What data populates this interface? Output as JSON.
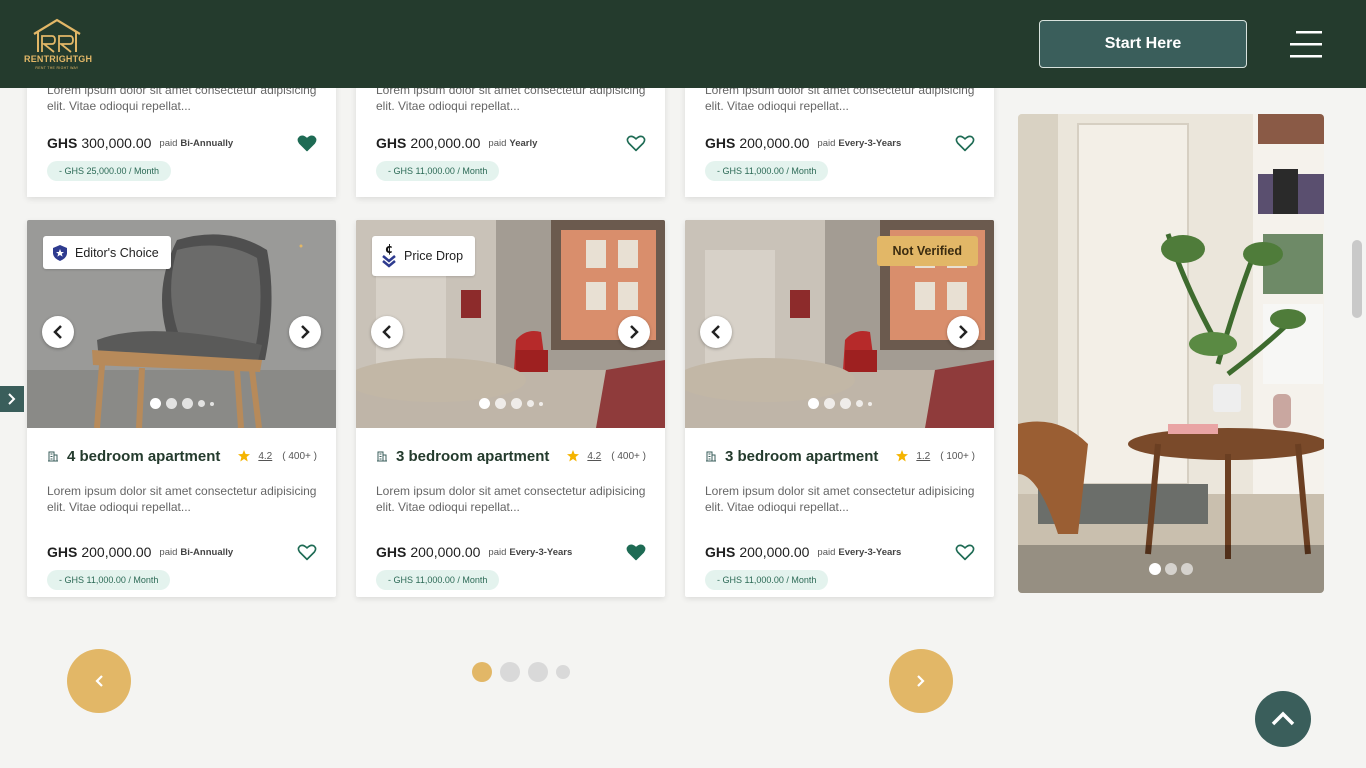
{
  "header": {
    "logo_text": "RENTRIGHTGH",
    "logo_tagline": "RENT THE RIGHT WAY",
    "start_button": "Start Here"
  },
  "top_cards": [
    {
      "desc": "Lorem ipsum dolor sit amet consectetur adipisicing elit. Vitae odioqui repellat...",
      "currency": "GHS",
      "amount": "300,000.00",
      "period_label": "paid",
      "period": "Bi-Annually",
      "monthly": "- GHS 25,000.00 / Month",
      "favorited": true
    },
    {
      "desc": "Lorem ipsum dolor sit amet consectetur adipisicing elit. Vitae odioqui repellat...",
      "currency": "GHS",
      "amount": "200,000.00",
      "period_label": "paid",
      "period": "Yearly",
      "monthly": "- GHS 11,000.00 / Month",
      "favorited": false
    },
    {
      "desc": "Lorem ipsum dolor sit amet consectetur adipisicing elit. Vitae odioqui repellat...",
      "currency": "GHS",
      "amount": "200,000.00",
      "period_label": "paid",
      "period": "Every-3-Years",
      "monthly": "- GHS 11,000.00 / Month",
      "favorited": false
    }
  ],
  "cards": [
    {
      "badge": "Editor's Choice",
      "title": "4 bedroom apartment",
      "rating": "4.2",
      "reviews": "( 400+ )",
      "desc": "Lorem ipsum dolor sit amet consectetur adipisicing elit. Vitae odioqui repellat...",
      "currency": "GHS",
      "amount": "200,000.00",
      "period_label": "paid",
      "period": "Bi-Annually",
      "monthly": "- GHS 11,000.00 / Month",
      "favorited": false
    },
    {
      "badge": "Price Drop",
      "title": "3 bedroom apartment",
      "rating": "4.2",
      "reviews": "( 400+ )",
      "desc": "Lorem ipsum dolor sit amet consectetur adipisicing elit. Vitae odioqui repellat...",
      "currency": "GHS",
      "amount": "200,000.00",
      "period_label": "paid",
      "period": "Every-3-Years",
      "monthly": "- GHS 11,000.00 / Month",
      "favorited": true
    },
    {
      "badge": "Not Verified",
      "title": "3 bedroom apartment",
      "rating": "1.2",
      "reviews": "( 100+ )",
      "desc": "Lorem ipsum dolor sit amet consectetur adipisicing elit. Vitae odioqui repellat...",
      "currency": "GHS",
      "amount": "200,000.00",
      "period_label": "paid",
      "period": "Every-3-Years",
      "monthly": "- GHS 11,000.00 / Month",
      "favorited": false
    }
  ],
  "colors": {
    "header_bg": "#243b2d",
    "accent_gold": "#e2b767",
    "teal": "#3a5e5b",
    "heart_green": "#1e6b54"
  },
  "icons": {
    "menu": "hamburger-icon",
    "heart": "heart-icon",
    "star": "star-icon",
    "building": "building-icon",
    "shield": "shield-icon",
    "price_drop": "price-drop-icon",
    "chevron_left": "chevron-left-icon",
    "chevron_right": "chevron-right-icon",
    "chevron_up": "chevron-up-icon"
  },
  "pagination": {
    "pages": 4,
    "active": 1
  }
}
